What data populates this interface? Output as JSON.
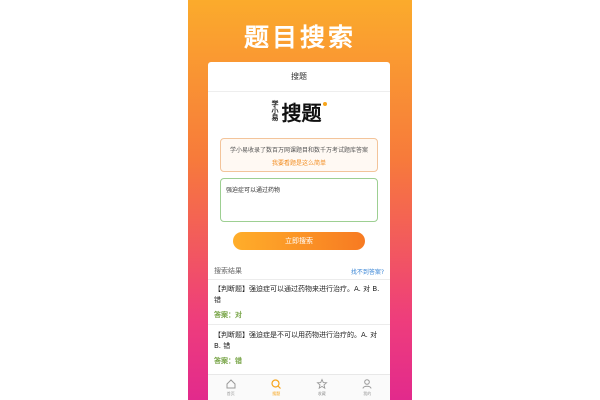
{
  "promo": {
    "title": "题目搜索"
  },
  "app": {
    "nav_title": "搜题",
    "logo": {
      "small_chars": [
        "学",
        "小",
        "易"
      ],
      "big_text": "搜题"
    },
    "info": {
      "text": "学小易收录了数百万网课题目和数千万考试题库答案",
      "link": "我要看题是这么简单"
    },
    "search": {
      "value": "强迫症可以通过药物"
    },
    "search_button": "立即搜索",
    "results": {
      "label": "搜索结果",
      "not_found_link": "找不到答案?",
      "items": [
        {
          "question": "【判断题】强迫症可以通过药物来进行治疗。A. 对 B. 错",
          "answer": "答案：对"
        },
        {
          "question": "【判断题】强迫症是不可以用药物进行治疗的。A. 对 B. 错",
          "answer": "答案：错"
        }
      ]
    },
    "tabs": [
      {
        "label": "首页",
        "icon": "home-icon",
        "active": false
      },
      {
        "label": "搜题",
        "icon": "search-icon",
        "active": true
      },
      {
        "label": "收藏",
        "icon": "star-icon",
        "active": false
      },
      {
        "label": "我的",
        "icon": "user-icon",
        "active": false
      }
    ]
  },
  "colors": {
    "accent": "#f7a51b",
    "answer": "#7aa64a",
    "link": "#3a86d6"
  }
}
